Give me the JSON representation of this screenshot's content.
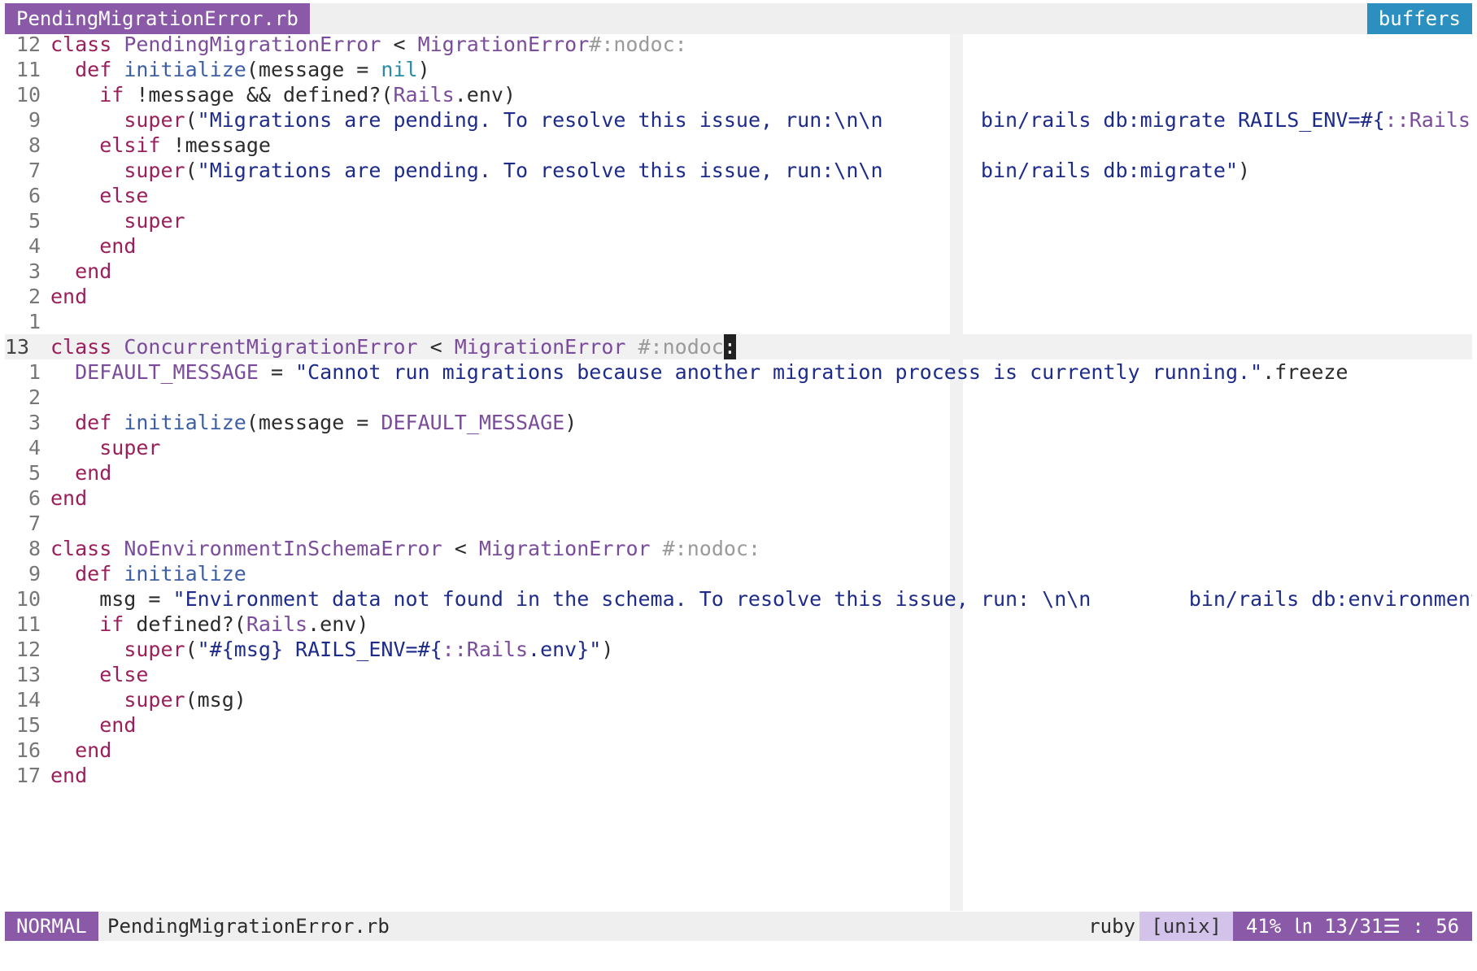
{
  "tabline": {
    "active_tab": "PendingMigrationError.rb",
    "buffers_label": "buffers"
  },
  "editor": {
    "lines": [
      {
        "num": "12",
        "html": "<span class=\"kw\">class</span> <span class=\"cls\">PendingMigrationError</span> &lt; <span class=\"cls\">MigrationError</span><span class=\"cm\">#:nodoc:</span>"
      },
      {
        "num": "11",
        "html": "  <span class=\"kw\">def</span> <span class=\"fn\">initialize</span>(message = <span class=\"nil\">nil</span>)"
      },
      {
        "num": "10",
        "html": "    <span class=\"kw\">if</span> !message &amp;&amp; defined?(<span class=\"cls\">Rails</span>.env)"
      },
      {
        "num": "9",
        "html": "      <span class=\"kw\">super</span>(<span class=\"str\">\"Migrations are pending. To resolve this issue, run:\\n\\n        bin/rails db:migrate RAILS_ENV=#{</span><span class=\"cls\">::Rails</span><span class=\"str\">.env}\"</span>)"
      },
      {
        "num": "8",
        "html": "    <span class=\"kw\">elsif</span> !message"
      },
      {
        "num": "7",
        "html": "      <span class=\"kw\">super</span>(<span class=\"str\">\"Migrations are pending. To resolve this issue, run:\\n\\n        bin/rails db:migrate\"</span>)"
      },
      {
        "num": "6",
        "html": "    <span class=\"kw\">else</span>"
      },
      {
        "num": "5",
        "html": "      <span class=\"kw\">super</span>"
      },
      {
        "num": "4",
        "html": "    <span class=\"kw\">end</span>"
      },
      {
        "num": "3",
        "html": "  <span class=\"kw\">end</span>"
      },
      {
        "num": "2",
        "html": "<span class=\"kw\">end</span>"
      },
      {
        "num": "1",
        "html": ""
      },
      {
        "num": "13",
        "current": true,
        "html": "<span class=\"kw\">class</span> <span class=\"cls\">ConcurrentMigrationError</span> &lt; <span class=\"cls\">MigrationError</span> <span class=\"cm\">#:nodoc</span><span class=\"cursor\">:</span>"
      },
      {
        "num": "1",
        "html": "  <span class=\"cls\">DEFAULT_MESSAGE</span> = <span class=\"str\">\"Cannot run migrations because another migration process is currently running.\"</span>.freeze"
      },
      {
        "num": "2",
        "html": ""
      },
      {
        "num": "3",
        "html": "  <span class=\"kw\">def</span> <span class=\"fn\">initialize</span>(message = <span class=\"cls\">DEFAULT_MESSAGE</span>)"
      },
      {
        "num": "4",
        "html": "    <span class=\"kw\">super</span>"
      },
      {
        "num": "5",
        "html": "  <span class=\"kw\">end</span>"
      },
      {
        "num": "6",
        "html": "<span class=\"kw\">end</span>"
      },
      {
        "num": "7",
        "html": ""
      },
      {
        "num": "8",
        "html": "<span class=\"kw\">class</span> <span class=\"cls\">NoEnvironmentInSchemaError</span> &lt; <span class=\"cls\">MigrationError</span> <span class=\"cm\">#:nodoc:</span>"
      },
      {
        "num": "9",
        "html": "  <span class=\"kw\">def</span> <span class=\"fn\">initialize</span>"
      },
      {
        "num": "10",
        "html": "    msg = <span class=\"str\">\"Environment data not found in the schema. To resolve this issue, run: \\n\\n        bin/rails db:environment:set\"</span>"
      },
      {
        "num": "11",
        "html": "    <span class=\"kw\">if</span> defined?(<span class=\"cls\">Rails</span>.env)"
      },
      {
        "num": "12",
        "html": "      <span class=\"kw\">super</span>(<span class=\"str\">\"#{msg} RAILS_ENV=#{</span><span class=\"cls\">::Rails</span><span class=\"str\">.env}\"</span>)"
      },
      {
        "num": "13",
        "html": "    <span class=\"kw\">else</span>"
      },
      {
        "num": "14",
        "html": "      <span class=\"kw\">super</span>(msg)"
      },
      {
        "num": "15",
        "html": "    <span class=\"kw\">end</span>"
      },
      {
        "num": "16",
        "html": "  <span class=\"kw\">end</span>"
      },
      {
        "num": "17",
        "html": "<span class=\"kw\">end</span>"
      }
    ]
  },
  "statusline": {
    "mode": "NORMAL",
    "filename": "PendingMigrationError.rb",
    "filetype": "ruby",
    "fileformat": "[unix]",
    "position": "41% ㏑ 13/31☰ : 56"
  },
  "colors": {
    "accent": "#8a5aa8",
    "buffers": "#2b8fbf",
    "keyword": "#9a1f5a",
    "class": "#7b4c9c",
    "string": "#1d2b8a",
    "comment": "#9a9a9a"
  }
}
